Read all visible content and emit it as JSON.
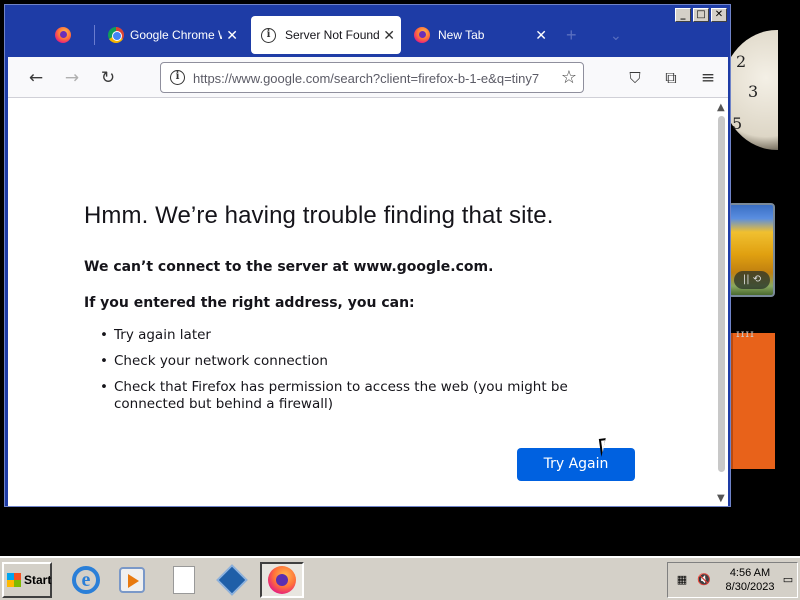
{
  "browser": {
    "tabs": [
      {
        "label": "",
        "icon": "firefox-icon",
        "active": false
      },
      {
        "label": "Google Chrome Web",
        "icon": "chrome-icon",
        "active": false
      },
      {
        "label": "Server Not Found",
        "icon": "info-icon",
        "active": true
      },
      {
        "label": "New Tab",
        "icon": "firefox-icon",
        "active": false
      }
    ],
    "new_tab_symbol": "+",
    "tab_list_symbol": "⌄",
    "url": "https://www.google.com/search?client=firefox-b-1-e&q=tiny7"
  },
  "error_page": {
    "title": "Hmm. We’re having trouble finding that site.",
    "line1": "We can’t connect to the server at www.google.com.",
    "line2": "If you entered the right address, you can:",
    "bullets": [
      "Try again later",
      "Check your network connection",
      "Check that Firefox has permission to access the web (you might be connected but behind a firewall)"
    ],
    "button": "Try Again"
  },
  "taskbar": {
    "start_label": "Start",
    "time": "4:56 AM",
    "date": "8/30/2023",
    "apps": [
      "internet-explorer",
      "media-player",
      "blank-document",
      "virtualbox",
      "firefox"
    ]
  },
  "colors": {
    "titlebar": "#1e3ca6",
    "accent_button": "#0061e0",
    "taskbar": "#d4d0c8"
  }
}
